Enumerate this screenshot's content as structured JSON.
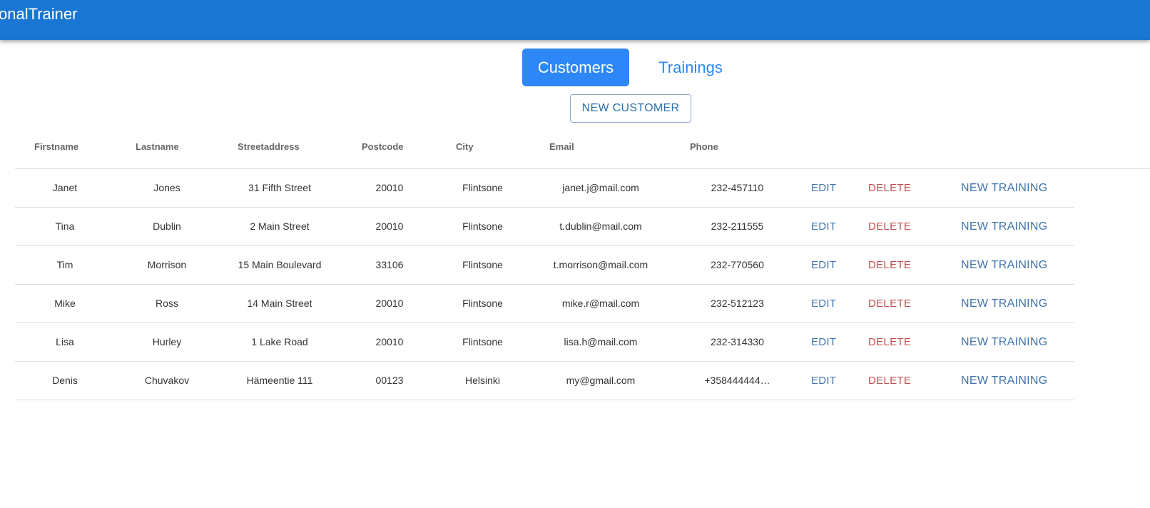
{
  "app": {
    "title": "onalTrainer"
  },
  "tabs": [
    {
      "label": "Customers"
    },
    {
      "label": "Trainings"
    }
  ],
  "toolbar": {
    "new_customer_label": "NEW CUSTOMER"
  },
  "table": {
    "columns": [
      "Firstname",
      "Lastname",
      "Streetaddress",
      "Postcode",
      "City",
      "Email",
      "Phone"
    ],
    "actions": {
      "edit": "EDIT",
      "delete": "DELETE",
      "new_training": "NEW TRAINING"
    },
    "rows": [
      {
        "firstname": "Janet",
        "lastname": "Jones",
        "streetaddress": "31 Fifth Street",
        "postcode": "20010",
        "city": "Flintsone",
        "email": "janet.j@mail.com",
        "phone": "232-457110"
      },
      {
        "firstname": "Tina",
        "lastname": "Dublin",
        "streetaddress": "2 Main Street",
        "postcode": "20010",
        "city": "Flintsone",
        "email": "t.dublin@mail.com",
        "phone": "232-211555"
      },
      {
        "firstname": "Tim",
        "lastname": "Morrison",
        "streetaddress": "15 Main Boulevard",
        "postcode": "33106",
        "city": "Flintsone",
        "email": "t.morrison@mail.com",
        "phone": "232-770560"
      },
      {
        "firstname": "Mike",
        "lastname": "Ross",
        "streetaddress": "14 Main Street",
        "postcode": "20010",
        "city": "Flintsone",
        "email": "mike.r@mail.com",
        "phone": "232-512123"
      },
      {
        "firstname": "Lisa",
        "lastname": "Hurley",
        "streetaddress": "1 Lake Road",
        "postcode": "20010",
        "city": "Flintsone",
        "email": "lisa.h@mail.com",
        "phone": "232-314330"
      },
      {
        "firstname": "Denis",
        "lastname": "Chuvakov",
        "streetaddress": "Hämeentie 111",
        "postcode": "00123",
        "city": "Helsinki",
        "email": "my@gmail.com",
        "phone": "+358444444…"
      }
    ]
  }
}
